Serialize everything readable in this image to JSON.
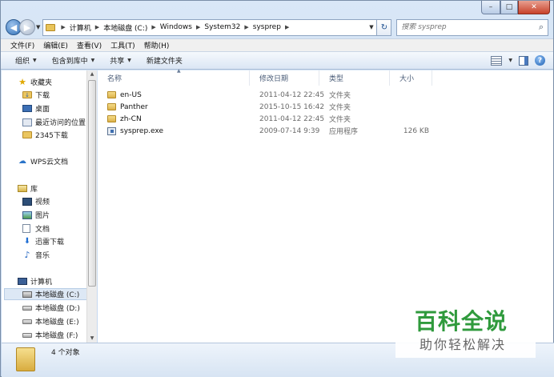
{
  "window": {
    "caption": {
      "minimize": "–",
      "maximize": "□",
      "close": "✕"
    }
  },
  "address_bar": {
    "breadcrumbs": [
      "计算机",
      "本地磁盘 (C:)",
      "Windows",
      "System32",
      "sysprep"
    ],
    "refresh": "↻"
  },
  "search": {
    "placeholder": "搜索 sysprep"
  },
  "menu": [
    "文件(F)",
    "编辑(E)",
    "查看(V)",
    "工具(T)",
    "帮助(H)"
  ],
  "toolbar": {
    "organize": "组织",
    "include_in_library": "包含到库中",
    "share": "共享",
    "new_folder": "新建文件夹"
  },
  "nav": {
    "favorites": "收藏夹",
    "downloads": "下载",
    "desktop": "桌面",
    "recent": "最近访问的位置",
    "downloads2345": "2345下载",
    "wps_cloud": "WPS云文档",
    "libraries": "库",
    "videos": "视频",
    "pictures": "图片",
    "documents": "文档",
    "thunder_downloads": "迅雷下载",
    "music": "音乐",
    "computer": "计算机",
    "drive_c": "本地磁盘 (C:)",
    "drive_d": "本地磁盘 (D:)",
    "drive_e": "本地磁盘 (E:)",
    "drive_f": "本地磁盘 (F:)"
  },
  "columns": {
    "name": "名称",
    "date": "修改日期",
    "type": "类型",
    "size": "大小"
  },
  "files": [
    {
      "name": "en-US",
      "date": "2011-04-12 22:45",
      "type": "文件夹",
      "size": "",
      "icon": "folder-icon"
    },
    {
      "name": "Panther",
      "date": "2015-10-15 16:42",
      "type": "文件夹",
      "size": "",
      "icon": "folder-icon"
    },
    {
      "name": "zh-CN",
      "date": "2011-04-12 22:45",
      "type": "文件夹",
      "size": "",
      "icon": "folder-icon"
    },
    {
      "name": "sysprep.exe",
      "date": "2009-07-14 9:39",
      "type": "应用程序",
      "size": "126 KB",
      "icon": "application-icon"
    }
  ],
  "status": {
    "item_count": "4 个对象"
  },
  "watermark": {
    "main": "百科全说",
    "sub": "助你轻松解决"
  }
}
